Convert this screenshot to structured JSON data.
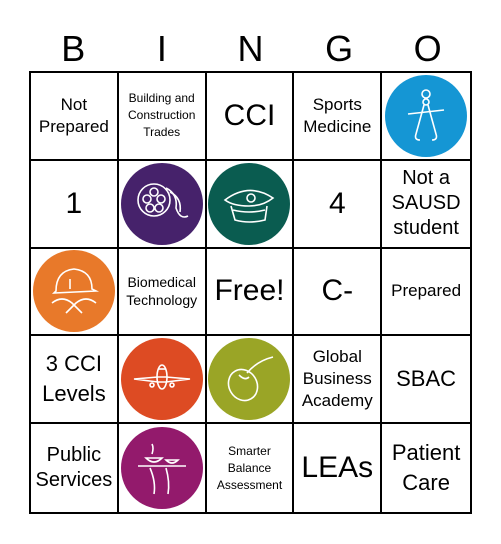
{
  "header": {
    "letters": [
      "B",
      "I",
      "N",
      "G",
      "O"
    ]
  },
  "cells": [
    {
      "type": "text",
      "text": "Not\nPrepared",
      "size": "t-m"
    },
    {
      "type": "text",
      "text": "Building and\nConstruction\nTrades",
      "size": "t-xs"
    },
    {
      "type": "text",
      "text": "CCI",
      "size": "t-xl"
    },
    {
      "type": "text",
      "text": "Sports\nMedicine",
      "size": "t-m"
    },
    {
      "type": "icon",
      "icon": "caliper-icon",
      "color": "#1596d4"
    },
    {
      "type": "text",
      "text": "1",
      "size": "t-xl"
    },
    {
      "type": "icon",
      "icon": "film-reel-icon",
      "color": "#46226b"
    },
    {
      "type": "icon",
      "icon": "captain-hat-icon",
      "color": "#0a5c50"
    },
    {
      "type": "text",
      "text": "4",
      "size": "t-xl"
    },
    {
      "type": "text",
      "text": "Not a\nSAUSD\nstudent",
      "size": "t-l"
    },
    {
      "type": "icon",
      "icon": "hard-hat-gloves-icon",
      "color": "#e8792a"
    },
    {
      "type": "text",
      "text": "Biomedical\nTechnology",
      "size": "t-s"
    },
    {
      "type": "text",
      "text": "Free!",
      "size": "t-xl"
    },
    {
      "type": "text",
      "text": "C-",
      "size": "t-xl"
    },
    {
      "type": "text",
      "text": "Prepared",
      "size": "t-m"
    },
    {
      "type": "text",
      "text": "3 CCI\nLevels",
      "size": "t-l2"
    },
    {
      "type": "icon",
      "icon": "airplane-icon",
      "color": "#dd4b23"
    },
    {
      "type": "icon",
      "icon": "computer-mouse-icon",
      "color": "#9aa526"
    },
    {
      "type": "text",
      "text": "Global\nBusiness\nAcademy",
      "size": "t-m"
    },
    {
      "type": "text",
      "text": "SBAC",
      "size": "t-l2"
    },
    {
      "type": "text",
      "text": "Public\nServices",
      "size": "t-l"
    },
    {
      "type": "icon",
      "icon": "serving-tray-icon",
      "color": "#931a6c"
    },
    {
      "type": "text",
      "text": "Smarter\nBalance\nAssessment",
      "size": "t-xs"
    },
    {
      "type": "text",
      "text": "LEAs",
      "size": "t-xl"
    },
    {
      "type": "text",
      "text": "Patient\nCare",
      "size": "t-l2"
    }
  ]
}
